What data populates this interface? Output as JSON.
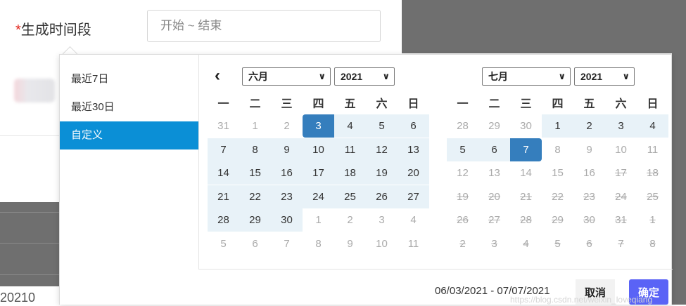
{
  "form": {
    "required_mark": "*",
    "label": "生成时间段",
    "input_value": "开始 ~ 结束"
  },
  "background": {
    "partial_text": "20210"
  },
  "ranges": [
    {
      "label": "最近7日",
      "active": false
    },
    {
      "label": "最近30日",
      "active": false
    },
    {
      "label": "自定义",
      "active": true
    }
  ],
  "weekdays": [
    "一",
    "二",
    "三",
    "四",
    "五",
    "六",
    "日"
  ],
  "calendars": [
    {
      "month": "六月",
      "year": "2021",
      "days": [
        {
          "d": "31",
          "s": "off"
        },
        {
          "d": "1",
          "s": "off"
        },
        {
          "d": "2",
          "s": "off"
        },
        {
          "d": "3",
          "s": "start"
        },
        {
          "d": "4",
          "s": "inrange"
        },
        {
          "d": "5",
          "s": "inrange"
        },
        {
          "d": "6",
          "s": "inrange"
        },
        {
          "d": "7",
          "s": "inrange"
        },
        {
          "d": "8",
          "s": "inrange"
        },
        {
          "d": "9",
          "s": "inrange"
        },
        {
          "d": "10",
          "s": "inrange"
        },
        {
          "d": "11",
          "s": "inrange"
        },
        {
          "d": "12",
          "s": "inrange"
        },
        {
          "d": "13",
          "s": "inrange"
        },
        {
          "d": "14",
          "s": "inrange"
        },
        {
          "d": "15",
          "s": "inrange"
        },
        {
          "d": "16",
          "s": "inrange"
        },
        {
          "d": "17",
          "s": "inrange"
        },
        {
          "d": "18",
          "s": "inrange"
        },
        {
          "d": "19",
          "s": "inrange"
        },
        {
          "d": "20",
          "s": "inrange"
        },
        {
          "d": "21",
          "s": "inrange"
        },
        {
          "d": "22",
          "s": "inrange"
        },
        {
          "d": "23",
          "s": "inrange"
        },
        {
          "d": "24",
          "s": "inrange"
        },
        {
          "d": "25",
          "s": "inrange"
        },
        {
          "d": "26",
          "s": "inrange"
        },
        {
          "d": "27",
          "s": "inrange"
        },
        {
          "d": "28",
          "s": "inrange"
        },
        {
          "d": "29",
          "s": "inrange"
        },
        {
          "d": "30",
          "s": "inrange"
        },
        {
          "d": "1",
          "s": "off"
        },
        {
          "d": "2",
          "s": "off"
        },
        {
          "d": "3",
          "s": "off"
        },
        {
          "d": "4",
          "s": "off"
        },
        {
          "d": "5",
          "s": "off"
        },
        {
          "d": "6",
          "s": "off"
        },
        {
          "d": "7",
          "s": "off"
        },
        {
          "d": "8",
          "s": "off"
        },
        {
          "d": "9",
          "s": "off"
        },
        {
          "d": "10",
          "s": "off"
        },
        {
          "d": "11",
          "s": "off"
        }
      ]
    },
    {
      "month": "七月",
      "year": "2021",
      "days": [
        {
          "d": "28",
          "s": "off"
        },
        {
          "d": "29",
          "s": "off"
        },
        {
          "d": "30",
          "s": "off"
        },
        {
          "d": "1",
          "s": "inrange"
        },
        {
          "d": "2",
          "s": "inrange"
        },
        {
          "d": "3",
          "s": "inrange"
        },
        {
          "d": "4",
          "s": "inrange"
        },
        {
          "d": "5",
          "s": "inrange"
        },
        {
          "d": "6",
          "s": "inrange"
        },
        {
          "d": "7",
          "s": "end"
        },
        {
          "d": "8",
          "s": "off"
        },
        {
          "d": "9",
          "s": "off"
        },
        {
          "d": "10",
          "s": "off"
        },
        {
          "d": "11",
          "s": "off"
        },
        {
          "d": "12",
          "s": "off"
        },
        {
          "d": "13",
          "s": "off"
        },
        {
          "d": "14",
          "s": "off"
        },
        {
          "d": "15",
          "s": "off"
        },
        {
          "d": "16",
          "s": "off"
        },
        {
          "d": "17",
          "s": "disabled"
        },
        {
          "d": "18",
          "s": "disabled"
        },
        {
          "d": "19",
          "s": "disabled"
        },
        {
          "d": "20",
          "s": "disabled"
        },
        {
          "d": "21",
          "s": "disabled"
        },
        {
          "d": "22",
          "s": "disabled"
        },
        {
          "d": "23",
          "s": "disabled"
        },
        {
          "d": "24",
          "s": "disabled"
        },
        {
          "d": "25",
          "s": "disabled"
        },
        {
          "d": "26",
          "s": "disabled"
        },
        {
          "d": "27",
          "s": "disabled"
        },
        {
          "d": "28",
          "s": "disabled"
        },
        {
          "d": "29",
          "s": "disabled"
        },
        {
          "d": "30",
          "s": "disabled"
        },
        {
          "d": "31",
          "s": "disabled"
        },
        {
          "d": "1",
          "s": "disabled"
        },
        {
          "d": "2",
          "s": "disabled"
        },
        {
          "d": "3",
          "s": "disabled"
        },
        {
          "d": "4",
          "s": "disabled"
        },
        {
          "d": "5",
          "s": "disabled"
        },
        {
          "d": "6",
          "s": "disabled"
        },
        {
          "d": "7",
          "s": "disabled"
        },
        {
          "d": "8",
          "s": "disabled"
        }
      ]
    }
  ],
  "prev_icon": "chevron-left-icon",
  "select_icon": "chevron-down-icon",
  "footer": {
    "selected_range": "06/03/2021 - 07/07/2021",
    "cancel_label": "取消",
    "apply_label": "确定"
  },
  "watermark": "https://blog.csdn.net/weixin_loveqiang",
  "colors": {
    "accent": "#0b8fd6",
    "selected_day": "#357ebd",
    "range_bg": "#e8f2f8",
    "apply_button": "#5a63f6",
    "required": "#e2231a"
  }
}
